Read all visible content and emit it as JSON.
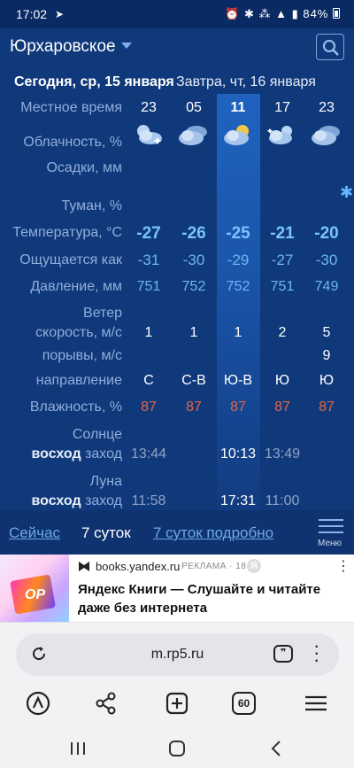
{
  "status": {
    "time": "17:02",
    "battery": "84%"
  },
  "header": {
    "city": "Юрхаровское"
  },
  "days": {
    "today": "Сегодня, ср, 15 января",
    "tomorrow": "Завтра, чт, 16 января"
  },
  "labels": {
    "local_time": "Местное время",
    "cloudiness": "Облачность, %",
    "precip": "Осадки, мм",
    "fog": "Туман, %",
    "temperature": "Температура, °C",
    "feels_like": "Ощущается как",
    "pressure": "Давление, мм",
    "wind": "Ветер",
    "wind_speed": "скорость, м/с",
    "gusts": "порывы, м/с",
    "direction": "направление",
    "humidity": "Влажность, %",
    "sun": "Солнце",
    "sunrise": "восход",
    "sunset": "заход",
    "moon": "Луна",
    "moonrise": "восход",
    "moonset": "заход"
  },
  "columns": [
    {
      "time": "23",
      "temp": "-27",
      "feels": "-31",
      "pressure": "751",
      "wind": "1",
      "gust": "",
      "dir": "С",
      "hum": "87",
      "icon": "night-cloud-icon"
    },
    {
      "time": "05",
      "temp": "-26",
      "feels": "-30",
      "pressure": "752",
      "wind": "1",
      "gust": "",
      "dir": "С-В",
      "hum": "87",
      "icon": "overcast-night-icon"
    },
    {
      "time": "11",
      "temp": "-25",
      "feels": "-29",
      "pressure": "752",
      "wind": "1",
      "gust": "",
      "dir": "Ю-В",
      "hum": "87",
      "icon": "partly-sunny-icon"
    },
    {
      "time": "17",
      "temp": "-21",
      "feels": "-27",
      "pressure": "751",
      "wind": "2",
      "gust": "",
      "dir": "Ю",
      "hum": "87",
      "icon": "night-cloud-icon"
    },
    {
      "time": "23",
      "temp": "-20",
      "feels": "-30",
      "pressure": "749",
      "wind": "5",
      "gust": "9",
      "dir": "Ю",
      "hum": "87",
      "icon": "overcast-snow-icon"
    }
  ],
  "sun": {
    "rise_today": "13:44",
    "rise_tomorrow": "10:13",
    "set_tomorrow": "13:49"
  },
  "moon": {
    "rise_today": "11:58",
    "rise_tomorrow": "17:31",
    "set_tomorrow": "11:00"
  },
  "bottom_nav": {
    "now": "Сейчас",
    "seven_days": "7 суток",
    "seven_days_detail": "7 суток подробно",
    "menu": "Меню"
  },
  "ad": {
    "domain": "books.yandex.ru",
    "tag": "РЕКЛАМА · 18+",
    "title": "Яндекс Книги — Слушайте и читайте даже без интернета"
  },
  "browser": {
    "url": "m.rp5.ru",
    "tabs": "60"
  },
  "colors": {
    "app_bg": "#10397b",
    "accent": "#79c3ff",
    "humidity": "#e1664a"
  }
}
